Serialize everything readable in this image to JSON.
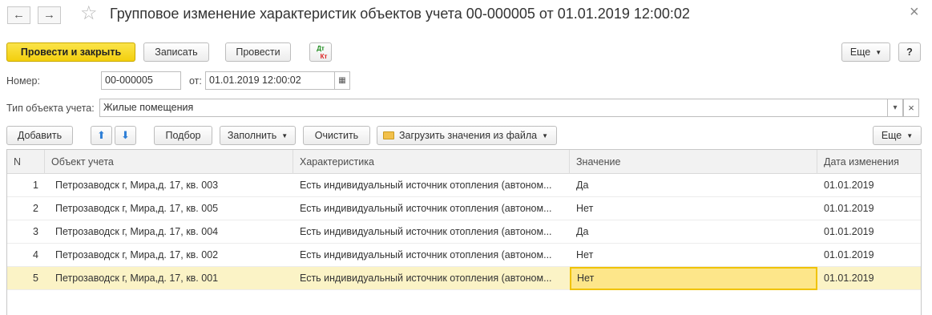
{
  "window": {
    "title": "Групповое изменение характеристик объектов учета 00-000005 от 01.01.2019 12:00:02"
  },
  "toolbar": {
    "post_and_close": "Провести и закрыть",
    "save": "Записать",
    "post": "Провести",
    "dt_kt_top": "Дт",
    "dt_kt_bottom": "Кт",
    "more": "Еще",
    "help": "?"
  },
  "form": {
    "number_label": "Номер:",
    "number_value": "00-000005",
    "date_label": "от:",
    "date_value": "01.01.2019 12:00:02",
    "object_type_label": "Тип объекта учета:",
    "object_type_value": "Жилые помещения"
  },
  "table_toolbar": {
    "add": "Добавить",
    "pick": "Подбор",
    "fill": "Заполнить",
    "clear": "Очистить",
    "load_from_file": "Загрузить значения из файла",
    "more": "Еще"
  },
  "table": {
    "columns": [
      "N",
      "Объект учета",
      "Характеристика",
      "Значение",
      "Дата изменения"
    ],
    "rows": [
      {
        "n": "1",
        "object": "Петрозаводск г, Мира,д. 17, кв. 003",
        "characteristic": "Есть индивидуальный источник отопления (автоном...",
        "value": "Да",
        "date": "01.01.2019"
      },
      {
        "n": "2",
        "object": "Петрозаводск г, Мира,д. 17, кв. 005",
        "characteristic": "Есть индивидуальный источник отопления (автоном...",
        "value": "Нет",
        "date": "01.01.2019"
      },
      {
        "n": "3",
        "object": "Петрозаводск г, Мира,д. 17, кв. 004",
        "characteristic": "Есть индивидуальный источник отопления (автоном...",
        "value": "Да",
        "date": "01.01.2019"
      },
      {
        "n": "4",
        "object": "Петрозаводск г, Мира,д. 17, кв. 002",
        "characteristic": "Есть индивидуальный источник отопления (автоном...",
        "value": "Нет",
        "date": "01.01.2019"
      },
      {
        "n": "5",
        "object": "Петрозаводск г, Мира,д. 17, кв. 001",
        "characteristic": "Есть индивидуальный источник отопления (автоном...",
        "value": "Нет",
        "date": "01.01.2019"
      }
    ]
  },
  "colors": {
    "primary_button": "#f3cf0d",
    "selected_row": "#fbf3c6",
    "current_cell": "#fde68a",
    "arrow_blue": "#2f7fd6"
  }
}
